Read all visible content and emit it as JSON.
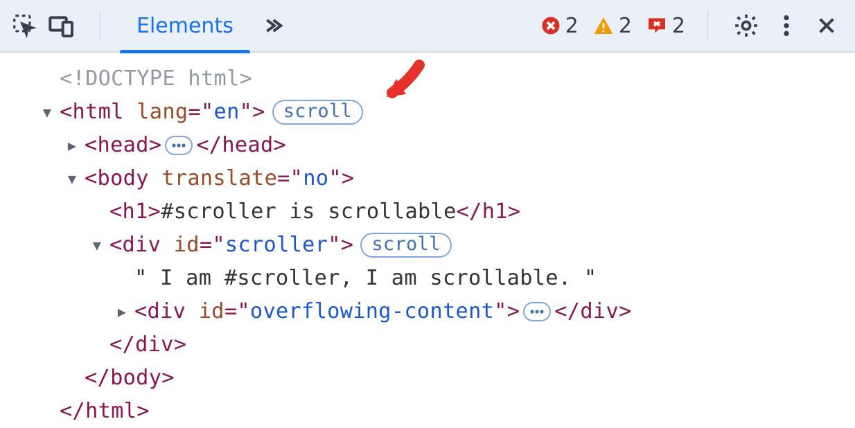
{
  "toolbar": {
    "inspect_icon": "inspect",
    "device_icon": "device-toolbar",
    "tabs": {
      "elements": "Elements"
    },
    "more_icon": "more-tabs",
    "errors_count": "2",
    "warnings_count": "2",
    "issues_count": "2",
    "settings_icon": "settings",
    "kebab_icon": "more-menu",
    "close_icon": "close"
  },
  "tree": {
    "doctype": "<!DOCTYPE html>",
    "html_lang": "en",
    "body_translate": "no",
    "h1_text": "#scroller is scrollable",
    "div_scroller_id": "scroller",
    "scroller_text": "\" I am #scroller, I am scrollable. \"",
    "overflow_id": "overflowing-content",
    "scroll_badge": "scroll"
  }
}
